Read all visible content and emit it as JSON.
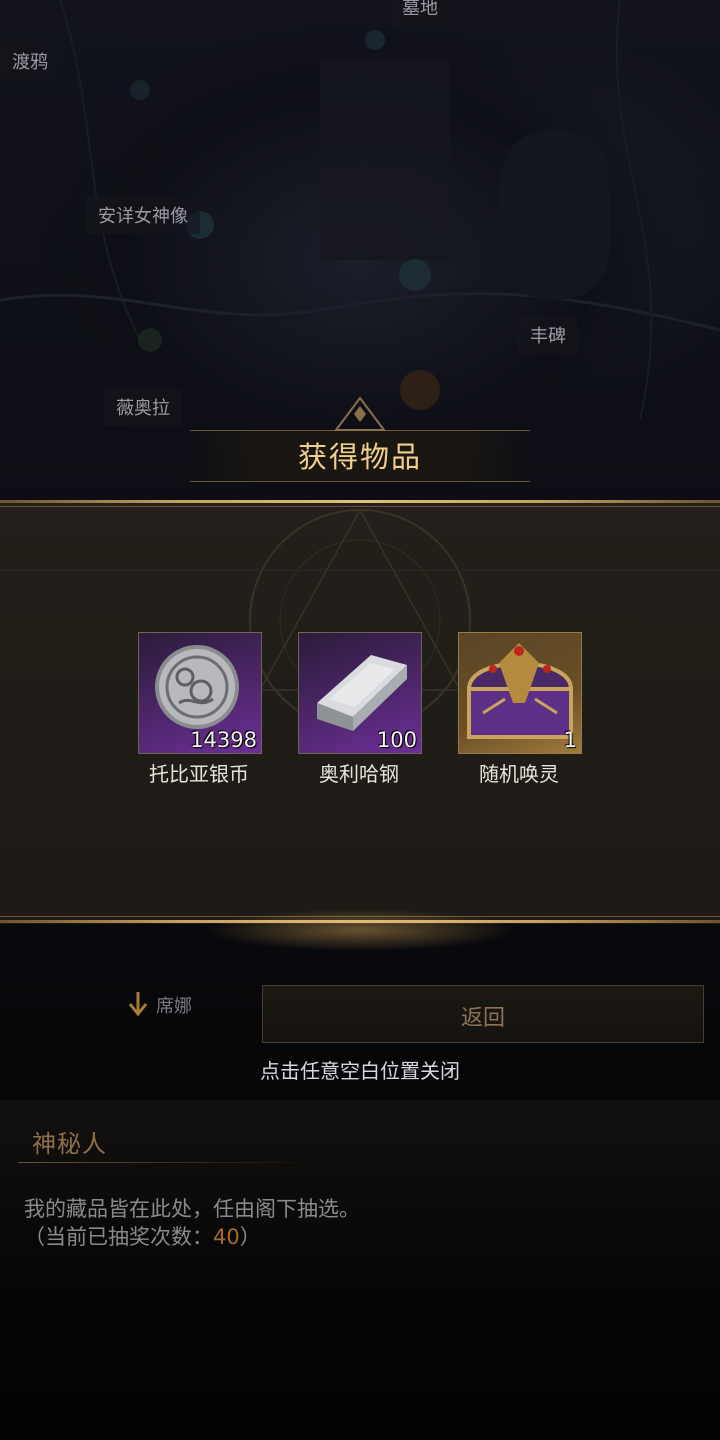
{
  "map": {
    "labels": [
      "渡鸦",
      "安详女神像",
      "丰碑",
      "薇奥拉",
      "墓地"
    ]
  },
  "modal": {
    "title": "获得物品",
    "items": [
      {
        "name": "托比亚银币",
        "count": "14398",
        "rarity": "purple",
        "icon": "silver-coin-icon"
      },
      {
        "name": "奥利哈钢",
        "count": "100",
        "rarity": "purple",
        "icon": "metal-ingot-icon"
      },
      {
        "name": "随机唤灵",
        "count": "1",
        "rarity": "gold",
        "icon": "treasure-chest-icon"
      }
    ],
    "close_hint": "点击任意空白位置关闭"
  },
  "underlay": {
    "return_button": "返回",
    "left_label": "席娜",
    "npc_name": "神秘人",
    "dialog_line1": "我的藏品皆在此处，任由阁下抽选。",
    "dialog_line2_prefix": "（当前已抽奖次数：",
    "draw_count": "40",
    "dialog_line2_suffix": "）"
  },
  "colors": {
    "title_gold": "#f0cf8a",
    "border_gold": "#c8a060",
    "rarity_purple": "#6d2e97",
    "rarity_gold": "#a07a3c",
    "count_orange": "#a8692e"
  }
}
